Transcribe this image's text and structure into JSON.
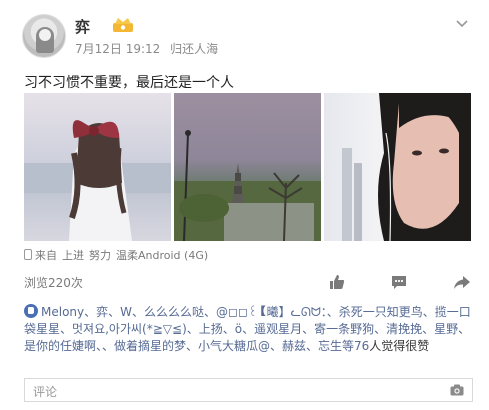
{
  "post": {
    "author": "弈",
    "date": "7月12日 19:12",
    "status": "归还人海",
    "text": "习不习惯不重要，最后还是一个人",
    "source": {
      "prefix": "来自",
      "tags": [
        "上进",
        "努力",
        "温柔Android (4G)"
      ]
    },
    "views": "浏览220次",
    "likes_text": "Melony、弈、W、么么么么哒、@◻◻꒰【曦】ᓚᘏᗢ：、杀死一只知更鸟、揽一口袋星星、멋져요,아가씨(*≧▽≦)、上扬、ö、遥观星月、寄一条野狗、清挽挽、星野、是你的任婕啊、、做着摘星的梦、小气大糖瓜@、赫兹、忘生等76",
    "likes_suffix": "人觉得很赞",
    "comment_placeholder": "评论"
  },
  "icons": {
    "vip": "vip-crown-icon",
    "chevron": "chevron-down-icon",
    "like": "thumbs-up-icon",
    "comment": "comment-bubble-icon",
    "share": "share-arrow-icon",
    "camera": "camera-icon"
  },
  "colors": {
    "link": "#576b95",
    "vip": "#f3b733",
    "meta": "#8a8a8a"
  }
}
